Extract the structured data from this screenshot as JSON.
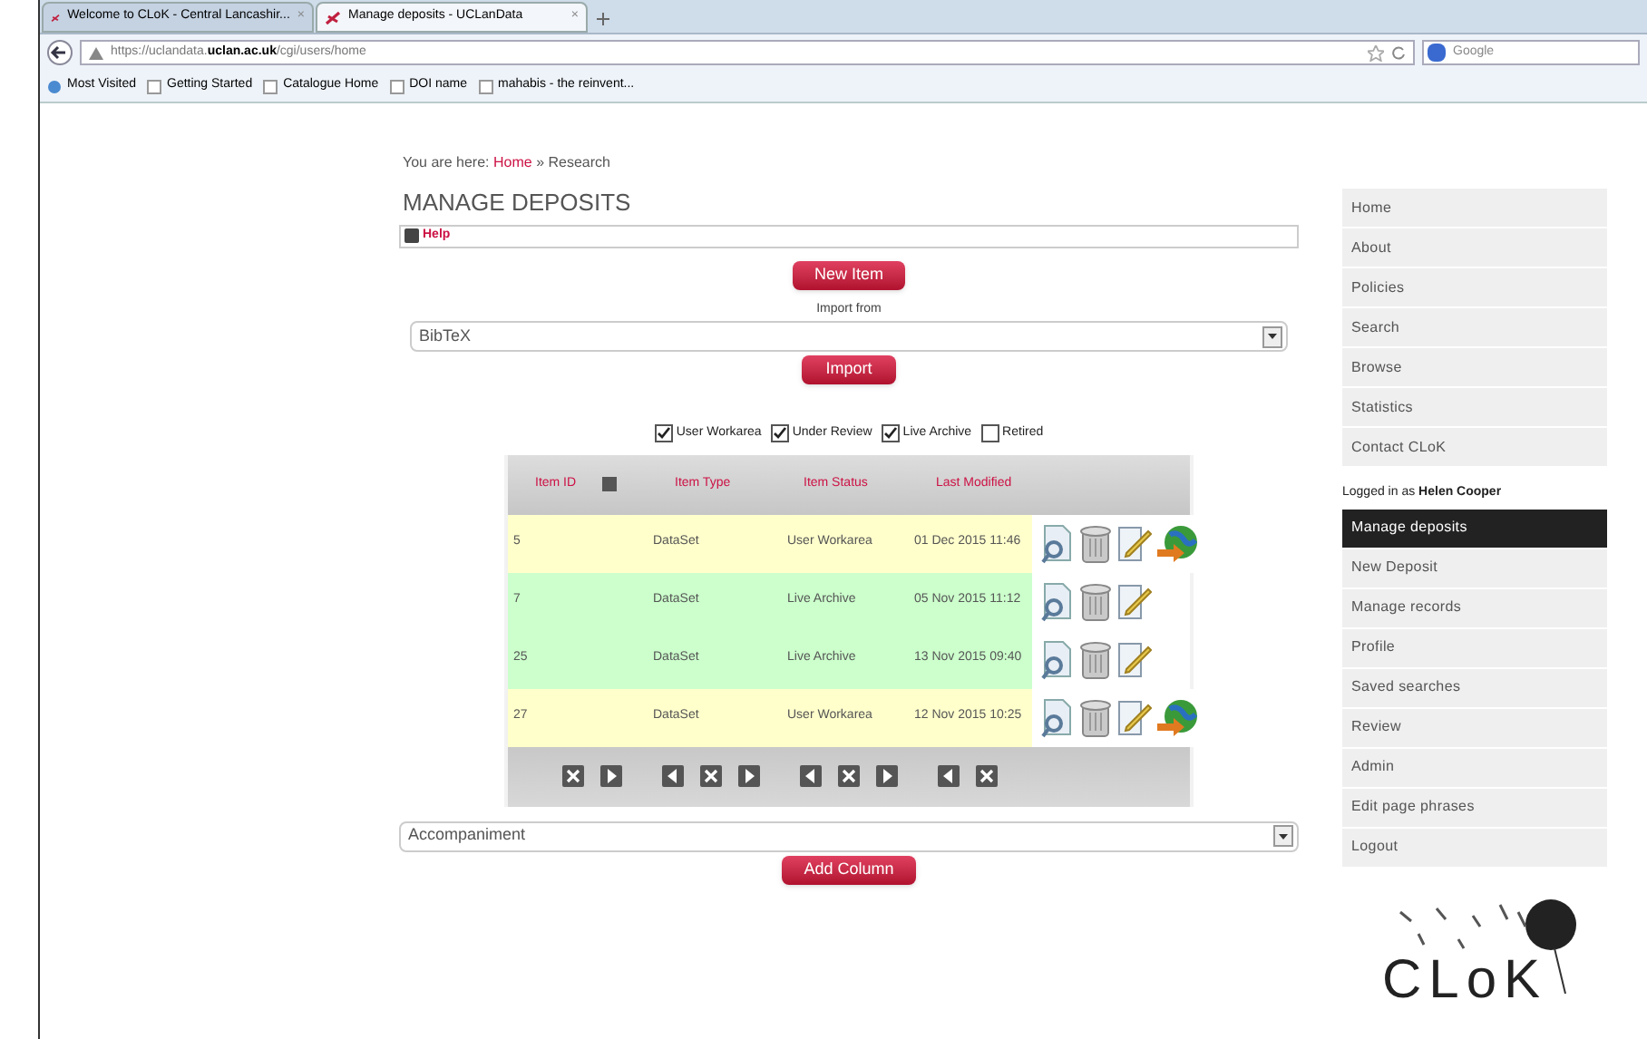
{
  "browser": {
    "tabs": [
      {
        "label": "Welcome to CLoK - Central Lancashir...",
        "close": "×",
        "selected": false
      },
      {
        "label": "Manage deposits - UCLanData",
        "close": "×",
        "selected": true
      }
    ],
    "url_prefix": "https://uclandata.",
    "url_host": "uclan.ac.uk",
    "url_path": "/cgi/users/home",
    "search_placeholder": "Google",
    "bookmarks": [
      {
        "label": "Most Visited",
        "kind": "site"
      },
      {
        "label": "Getting Started",
        "kind": "page"
      },
      {
        "label": "Catalogue Home",
        "kind": "page"
      },
      {
        "label": "DOI name",
        "kind": "page"
      },
      {
        "label": "mahabis - the reinvent...",
        "kind": "page"
      }
    ]
  },
  "breadcrumb": {
    "prefix": "You are here:",
    "link": "Home",
    "rest": "» Research"
  },
  "title": "MANAGE DEPOSITS",
  "help": "Help",
  "new_item": "New Item",
  "import_label": "Import from",
  "import_select": "BibTeX",
  "import_button": "Import",
  "filters": [
    {
      "label": "User Workarea",
      "checked": true
    },
    {
      "label": "Under Review",
      "checked": true
    },
    {
      "label": "Live Archive",
      "checked": true
    },
    {
      "label": "Retired",
      "checked": false
    }
  ],
  "table": {
    "columns": [
      "Item ID",
      "Item Type",
      "Item Status",
      "Last Modified"
    ],
    "rows": [
      {
        "id": "5",
        "type": "DataSet",
        "status": "User Workarea",
        "modified": "01 Dec 2015 11:46",
        "kind": "workarea",
        "actions": [
          {
            "kind": "view"
          },
          {
            "kind": "delete"
          },
          {
            "kind": "edit"
          },
          {
            "kind": "deposit"
          }
        ]
      },
      {
        "id": "7",
        "type": "DataSet",
        "status": "Live Archive",
        "modified": "05 Nov 2015 11:12",
        "kind": "archive",
        "actions": [
          {
            "kind": "view"
          },
          {
            "kind": "delete"
          },
          {
            "kind": "edit"
          }
        ]
      },
      {
        "id": "25",
        "type": "DataSet",
        "status": "Live Archive",
        "modified": "13 Nov 2015 09:40",
        "kind": "archive",
        "actions": [
          {
            "kind": "view"
          },
          {
            "kind": "delete"
          },
          {
            "kind": "edit"
          }
        ]
      },
      {
        "id": "27",
        "type": "DataSet",
        "status": "User Workarea",
        "modified": "12 Nov 2015 10:25",
        "kind": "workarea",
        "actions": [
          {
            "kind": "view"
          },
          {
            "kind": "delete"
          },
          {
            "kind": "edit"
          },
          {
            "kind": "deposit"
          }
        ]
      }
    ],
    "column_controls": [
      [
        {
          "kind": "remove"
        },
        {
          "kind": "right"
        }
      ],
      [
        {
          "kind": "left"
        },
        {
          "kind": "remove"
        },
        {
          "kind": "right"
        }
      ],
      [
        {
          "kind": "left"
        },
        {
          "kind": "remove"
        },
        {
          "kind": "right"
        }
      ],
      [
        {
          "kind": "left"
        },
        {
          "kind": "remove"
        }
      ]
    ]
  },
  "column_select": "Accompaniment",
  "add_column": "Add Column",
  "menu": [
    {
      "label": "Home",
      "selected": false
    },
    {
      "label": "About",
      "selected": false
    },
    {
      "label": "Policies",
      "selected": false
    },
    {
      "label": "Search",
      "selected": false
    },
    {
      "label": "Browse",
      "selected": false
    },
    {
      "label": "Statistics",
      "selected": false
    },
    {
      "label": "Contact CLoK",
      "selected": false
    }
  ],
  "login": {
    "prefix": "Logged in as",
    "user": "Helen Cooper"
  },
  "user_menu": [
    {
      "label": "Manage deposits",
      "selected": true
    },
    {
      "label": "New Deposit",
      "selected": false
    },
    {
      "label": "Manage records",
      "selected": false
    },
    {
      "label": "Profile",
      "selected": false
    },
    {
      "label": "Saved searches",
      "selected": false
    },
    {
      "label": "Review",
      "selected": false
    },
    {
      "label": "Admin",
      "selected": false
    },
    {
      "label": "Edit page phrases",
      "selected": false
    },
    {
      "label": "Logout",
      "selected": false
    }
  ],
  "logo": "CLoK"
}
